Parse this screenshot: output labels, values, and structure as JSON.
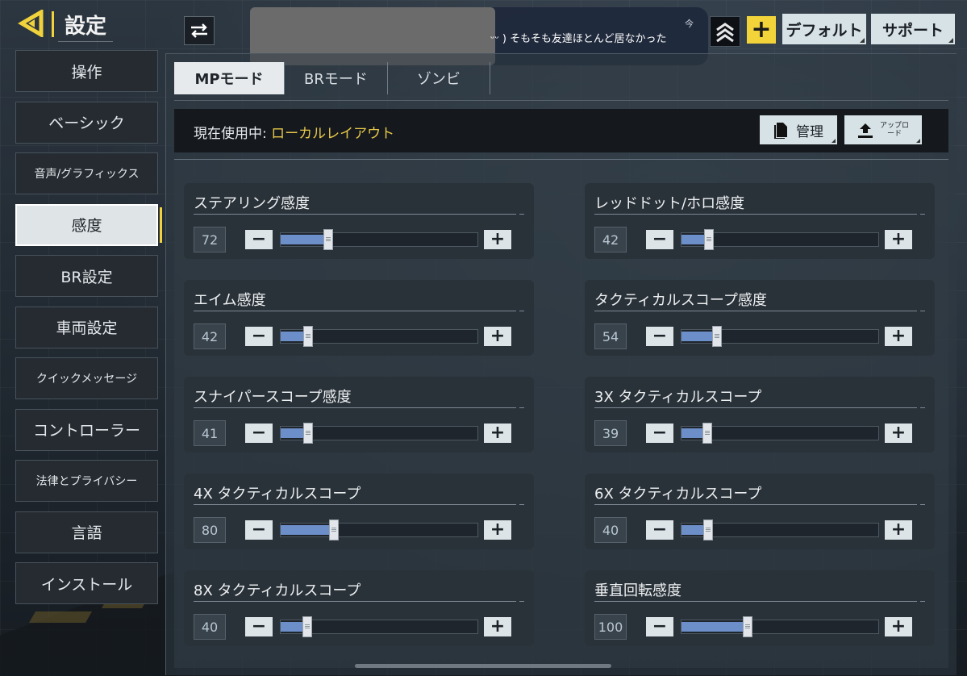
{
  "header": {
    "title": "設定",
    "default_label": "デフォルト",
    "support_label": "サポート",
    "plus_label": "+"
  },
  "notification": {
    "text": "ᵕᵕ ) そもそも友達ほとんど居なかった",
    "time": "今"
  },
  "sidebar": {
    "items": [
      {
        "label": "操作"
      },
      {
        "label": "ベーシック"
      },
      {
        "label": "音声/グラフィックス"
      },
      {
        "label": "感度",
        "active": true
      },
      {
        "label": "BR設定"
      },
      {
        "label": "車両設定"
      },
      {
        "label": "クイックメッセージ"
      },
      {
        "label": "コントローラー"
      },
      {
        "label": "法律とプライバシー"
      },
      {
        "label": "言語"
      },
      {
        "label": "インストール"
      }
    ]
  },
  "tabs": [
    {
      "label": "MPモード",
      "active": true
    },
    {
      "label": "BRモード"
    },
    {
      "label": "ゾンビ"
    }
  ],
  "layout": {
    "prefix": "現在使用中:",
    "value": "ローカルレイアウト",
    "manage_label": "管理",
    "upload_label": "アップロード"
  },
  "sensitivity": [
    {
      "label": "ステアリング感度",
      "value": "72",
      "fraction": 0.24
    },
    {
      "label": "レッドドット/ホロ感度",
      "value": "42",
      "fraction": 0.14
    },
    {
      "label": "エイム感度",
      "value": "42",
      "fraction": 0.14
    },
    {
      "label": "タクティカルスコープ感度",
      "value": "54",
      "fraction": 0.18
    },
    {
      "label": "スナイパースコープ感度",
      "value": "41",
      "fraction": 0.137
    },
    {
      "label": "3X タクティカルスコープ",
      "value": "39",
      "fraction": 0.13
    },
    {
      "label": "4X タクティカルスコープ",
      "value": "80",
      "fraction": 0.267
    },
    {
      "label": "6X タクティカルスコープ",
      "value": "40",
      "fraction": 0.133
    },
    {
      "label": "8X タクティカルスコープ",
      "value": "40",
      "fraction": 0.133
    },
    {
      "label": "垂直回転感度",
      "value": "100",
      "fraction": 0.333
    }
  ],
  "colors": {
    "accent": "#f0d23c",
    "slider_fill": "#6d8fc9",
    "layout_value": "#e8c84a"
  },
  "icons": {
    "back": "back-arrow-icon",
    "swap": "swap-arrows-icon",
    "rank": "rank-chevron-icon",
    "manage": "document-icon",
    "upload": "upload-icon"
  }
}
